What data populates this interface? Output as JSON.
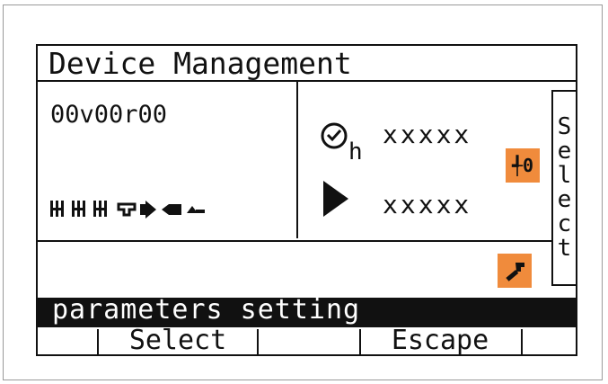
{
  "screen": {
    "title": "Device Management",
    "version": "00v00r00",
    "hours_value": "xxxxx",
    "hours_unit": "h",
    "count_value": "xxxxx",
    "reset_label": "╃0",
    "select_vertical": [
      "S",
      "e",
      "l",
      "e",
      "c",
      "t"
    ],
    "status_text": "parameters setting"
  },
  "softkeys": {
    "key1": "",
    "key2": "Select",
    "key3": "",
    "key4": "Escape",
    "key5": ""
  },
  "icons": {
    "status_icons": [
      "battery-bars-icon",
      "battery-bars-icon",
      "battery-bars-icon",
      "valve-icon",
      "flow-icon",
      "drop-icon",
      "arrow-icon"
    ],
    "hours_icon": "clock-icon",
    "count_icon": "play-icon",
    "reset_icon": "counter-reset-icon",
    "tool_icon": "wrench-icon"
  },
  "colors": {
    "accent": "#f08b3c",
    "lcd_ink": "#111111",
    "background": "#ffffff"
  }
}
